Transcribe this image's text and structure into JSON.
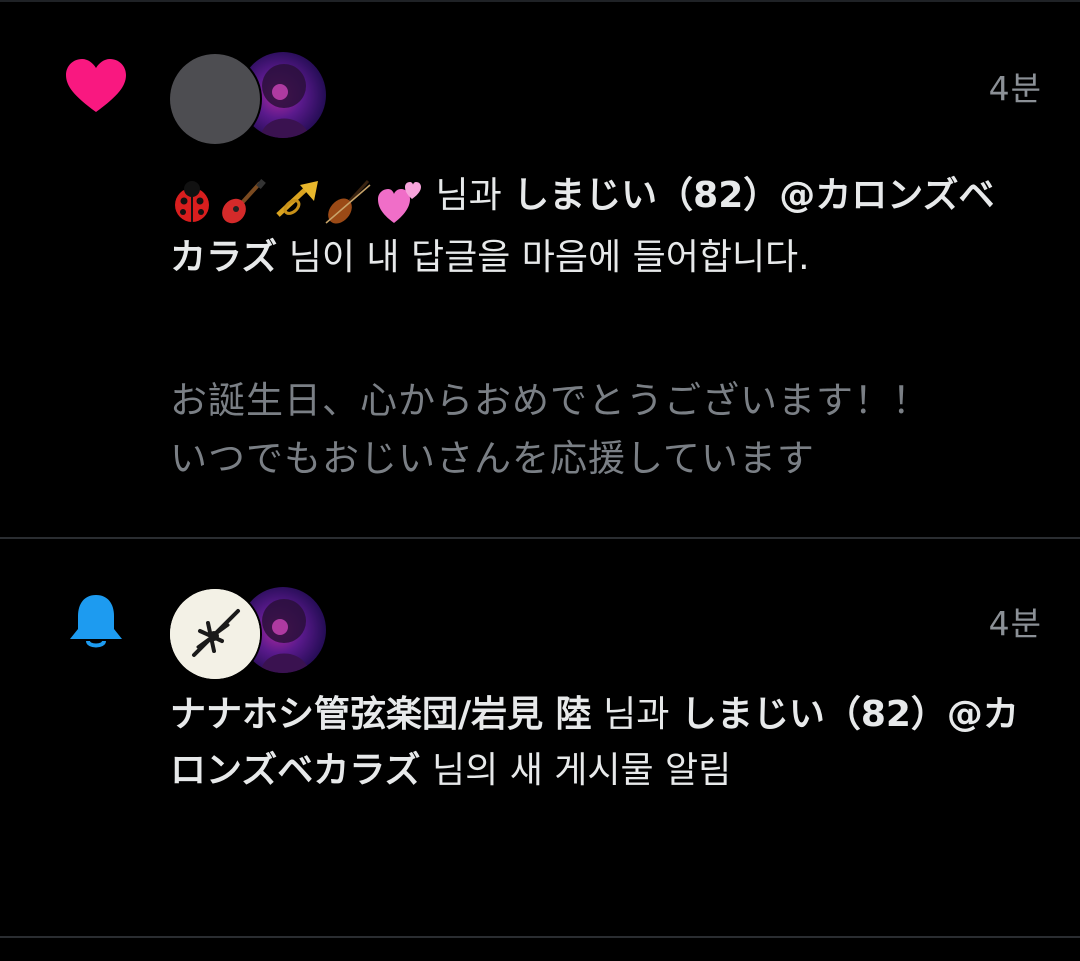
{
  "notifications": [
    {
      "type": "like",
      "type_icon": "heart-icon",
      "time": "4분",
      "emoji_name": "🐞🎸🎺🎻💕",
      "connector_1": " 님과 ",
      "user_2": "しまじい（82）@カロンズベカラズ",
      "action_text": " 님이 내 답글을 마음에 들어합니다.",
      "preview_line_1": "お誕生日、心からおめでとうございます！！",
      "preview_line_2": "いつでもおじいさんを応援しています"
    },
    {
      "type": "new-post",
      "type_icon": "bell-icon",
      "time": "4분",
      "user_1": "ナナホシ管弦楽団/岩見 陸",
      "connector_1": " 님과 ",
      "user_2": "しまじい（82）@カロンズベカラズ",
      "action_text": " 님의 새 게시물 알림"
    }
  ],
  "colors": {
    "like": "#f91880",
    "bell": "#1d9bf0",
    "text": "#e7e9ea",
    "muted": "#7a7f85",
    "divider": "#2a2d31"
  }
}
